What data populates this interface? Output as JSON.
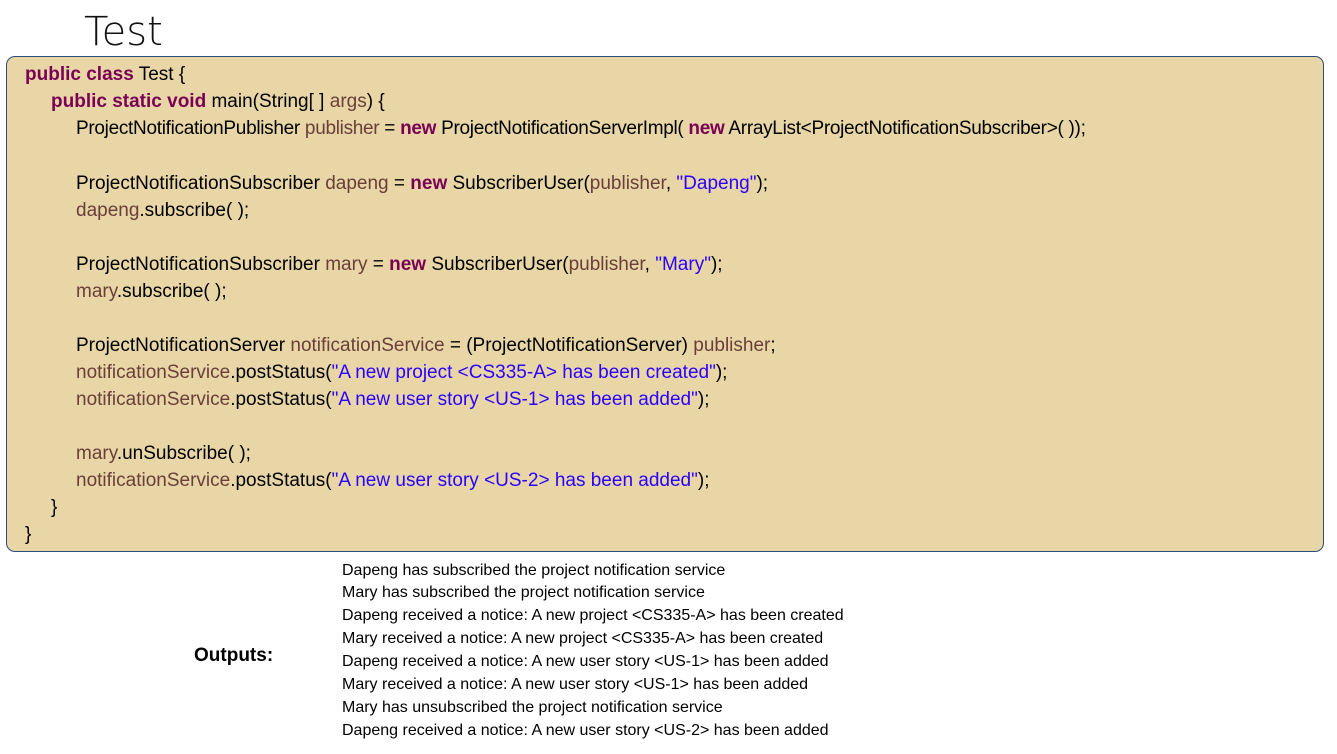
{
  "slide": {
    "title": "Test"
  },
  "code": {
    "l1": {
      "kw": "public class",
      "rest": " Test {"
    },
    "l2": {
      "kw": "public static void",
      "m1": " main(String[ ] ",
      "v1": "args",
      "m2": ") {"
    },
    "l3": {
      "t1": "ProjectNotificationPublisher ",
      "v1": "publisher",
      "t2": " = ",
      "k1": "new",
      "t3": " ProjectNotificationServerImpl( ",
      "k2": "new",
      "t4": " ArrayList<ProjectNotificationSubscriber>( ));"
    },
    "l4": {
      "t1": "ProjectNotificationSubscriber ",
      "v1": "dapeng",
      "t2": " = ",
      "k1": "new",
      "t3": " SubscriberUser(",
      "v2": "publisher",
      "t4": ", ",
      "s1": "\"Dapeng\"",
      "t5": ");"
    },
    "l5": {
      "v1": "dapeng",
      "t1": ".subscribe( );"
    },
    "l6": {
      "t1": "ProjectNotificationSubscriber ",
      "v1": "mary",
      "t2": " = ",
      "k1": "new",
      "t3": " SubscriberUser(",
      "v2": "publisher",
      "t4": ", ",
      "s1": "\"Mary\"",
      "t5": ");"
    },
    "l7": {
      "v1": "mary",
      "t1": ".subscribe( );"
    },
    "l8": {
      "t1": "ProjectNotificationServer ",
      "v1": "notificationService",
      "t2": " = (ProjectNotificationServer) ",
      "v2": "publisher",
      "t3": ";"
    },
    "l9": {
      "v1": "notificationService",
      "t1": ".postStatus(",
      "s1": "\"A new project <CS335-A> has been created\"",
      "t2": ");"
    },
    "l10": {
      "v1": "notificationService",
      "t1": ".postStatus(",
      "s1": "\"A new user story <US-1> has been added\"",
      "t2": ");"
    },
    "l11": {
      "v1": "mary",
      "t1": ".unSubscribe( );"
    },
    "l12": {
      "v1": "notificationService",
      "t1": ".postStatus(",
      "s1": "\"A new user story <US-2> has been added\"",
      "t2": ");"
    },
    "l13": "}",
    "l14": "}"
  },
  "outputs": {
    "label": "Outputs:",
    "lines": [
      "Dapeng has subscribed the project notification service",
      "Mary has subscribed the project notification service",
      "Dapeng received a notice: A new project <CS335-A> has been created",
      "Mary received a notice: A new project <CS335-A> has been created",
      "Dapeng received a notice: A new user story <US-1> has been added",
      "Mary received a notice: A new user story <US-1> has been added",
      "Mary has unsubscribed the project notification service",
      "Dapeng received a notice: A new user story <US-2> has been added"
    ]
  }
}
